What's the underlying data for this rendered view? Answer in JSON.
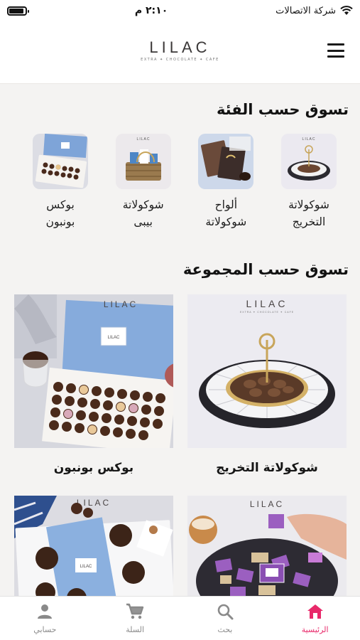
{
  "status_bar": {
    "carrier": "شركة الاتصالات",
    "time": "٢:١٠ م"
  },
  "header": {
    "logo_text": "LILAC",
    "logo_tagline": "EXTRA ✦ CHOCOLATE ✦ CAFE"
  },
  "categories_section": {
    "title": "تسوق حسب الفئة",
    "items": [
      {
        "line1": "شوكولاتة",
        "line2": "التخريج"
      },
      {
        "line1": "ألواح",
        "line2": "شوكولاتة"
      },
      {
        "line1": "شوكولاتة",
        "line2": "بيبى"
      },
      {
        "line1": "بوكس",
        "line2": "بونبون"
      }
    ]
  },
  "collections_section": {
    "title": "تسوق حسب المجموعة",
    "items": [
      {
        "title": "شوكولاتة التخريج"
      },
      {
        "title": "بوكس بونبون"
      },
      {
        "title": ""
      },
      {
        "title": ""
      }
    ]
  },
  "tabbar": {
    "items": [
      {
        "label": "الرئيسية",
        "icon": "home-icon",
        "active": true
      },
      {
        "label": "بحث",
        "icon": "search-icon",
        "active": false
      },
      {
        "label": "السلة",
        "icon": "cart-icon",
        "active": false
      },
      {
        "label": "حسابي",
        "icon": "user-icon",
        "active": false
      }
    ]
  },
  "colors": {
    "accent": "#e8296a",
    "page_bg": "#f4f3f2",
    "box_blue": "#7ea4d8",
    "purple": "#9b5fc0"
  }
}
